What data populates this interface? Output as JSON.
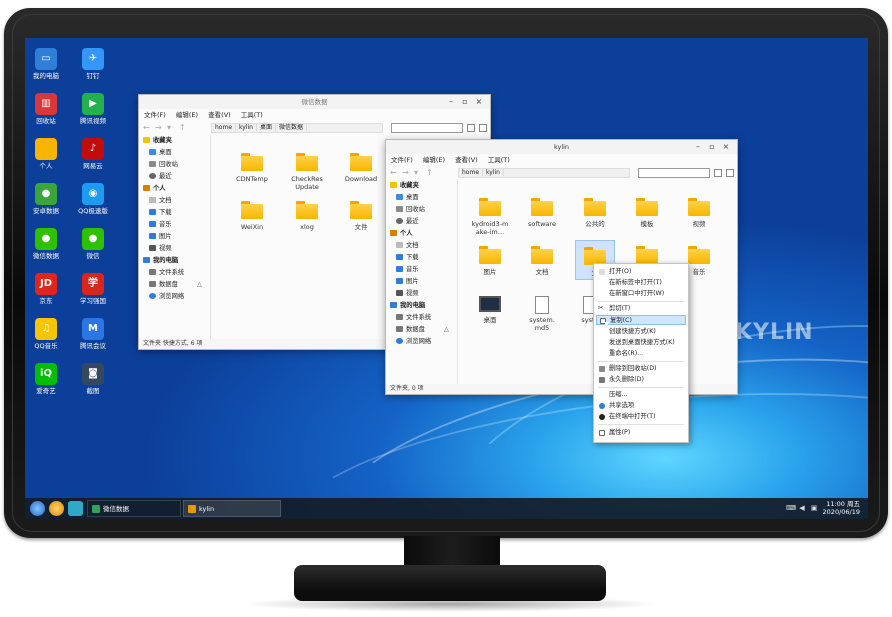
{
  "desktop": {
    "brand_text": "KYLIN",
    "icons": [
      {
        "label": "我的电脑",
        "icon": "computer-icon",
        "color": "#2f7fd8",
        "glyph": "▭"
      },
      {
        "label": "钉钉",
        "icon": "dingtalk-icon",
        "color": "#3296fa",
        "glyph": "✈"
      },
      {
        "label": "回收站",
        "icon": "trash-icon",
        "color": "#d9383a",
        "glyph": "▥"
      },
      {
        "label": "腾讯视频",
        "icon": "tencent-video-icon",
        "color": "#22b14c",
        "glyph": "▶"
      },
      {
        "label": "个人",
        "icon": "home-folder-icon",
        "color": "#f7b500",
        "glyph": ""
      },
      {
        "label": "网易云",
        "icon": "netease-icon",
        "color": "#c20c0c",
        "glyph": "♪"
      },
      {
        "label": "安卓数据",
        "icon": "android-data-icon",
        "color": "#3aa53a",
        "glyph": "●"
      },
      {
        "label": "QQ极速版",
        "icon": "qq-icon",
        "color": "#1d9bf0",
        "glyph": "◉"
      },
      {
        "label": "微信数据",
        "icon": "wechat-data-icon",
        "color": "#2dc100",
        "glyph": "●"
      },
      {
        "label": "微信",
        "icon": "wechat-icon",
        "color": "#2dc100",
        "glyph": "●"
      },
      {
        "label": "京东",
        "icon": "jd-icon",
        "color": "#e1251b",
        "glyph": "JD"
      },
      {
        "label": "学习强国",
        "icon": "xuexi-icon",
        "color": "#d7261e",
        "glyph": "学"
      },
      {
        "label": "QQ音乐",
        "icon": "qq-music-icon",
        "color": "#f5c500",
        "glyph": "♫"
      },
      {
        "label": "腾讯会议",
        "icon": "tencent-meeting-icon",
        "color": "#2b76e5",
        "glyph": "M"
      },
      {
        "label": "爱奇艺",
        "icon": "iqiyi-icon",
        "color": "#00be06",
        "glyph": "iQ"
      },
      {
        "label": "截图",
        "icon": "screenshot-icon",
        "color": "#34495e",
        "glyph": "◙"
      }
    ]
  },
  "window_back": {
    "title": "微信数据",
    "menu": [
      "文件(F)",
      "编辑(E)",
      "查看(V)",
      "工具(T)"
    ],
    "crumbs": [
      "home",
      "kylin",
      "桌面",
      "微信数据"
    ],
    "status": "文件夹 快捷方式, 6 项",
    "items": [
      "CDNTemp",
      "CheckResUpdate",
      "Download",
      "WeiXin",
      "xlog",
      "文件"
    ]
  },
  "window_front": {
    "title": "kylin",
    "menu": [
      "文件(F)",
      "编辑(E)",
      "查看(V)",
      "工具(T)"
    ],
    "crumbs": [
      "home",
      "kylin"
    ],
    "status": "文件夹, 0 项",
    "items": [
      "kydroid3-make-im…",
      "software",
      "公共的",
      "模板",
      "视频",
      "图片",
      "文档",
      "文",
      "",
      "音乐",
      "桌面",
      "system.md5",
      "syste"
    ]
  },
  "sidebar": {
    "favorites": "收藏夹",
    "fav_items": [
      "桌面",
      "回收站",
      "最近"
    ],
    "personal": "个人",
    "personal_items": [
      "文档",
      "下载",
      "音乐",
      "图片",
      "视频"
    ],
    "computer": "我的电脑",
    "computer_items": [
      "文件系统",
      "数据盘",
      "浏览网络"
    ]
  },
  "context_menu": {
    "items": [
      "打开(O)",
      "在新标签中打开(T)",
      "在新窗口中打开(W)",
      "剪切(T)",
      "复制(C)",
      "创建快捷方式(K)",
      "发送到桌面快捷方式(K)",
      "重命名(R)...",
      "删除到回收站(D)",
      "永久删除(D)",
      "压缩...",
      "共享选项",
      "在终端中打开(T)",
      "属性(P)"
    ],
    "highlighted": "复制(C)"
  },
  "taskbar": {
    "tasks": [
      "微信数据",
      "kylin"
    ],
    "time": "11:00 周五",
    "date": "2020/06/19"
  },
  "colors": {
    "accent": "#2f7fd8",
    "folder": "#f7b500",
    "taskbar": "#121c28"
  }
}
